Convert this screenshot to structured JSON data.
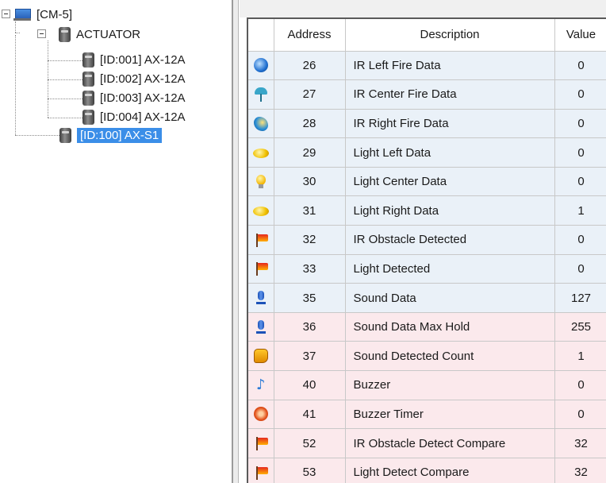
{
  "tree": {
    "root": "[CM-5]",
    "group": "ACTUATOR",
    "children": [
      "[ID:001] AX-12A",
      "[ID:002] AX-12A",
      "[ID:003] AX-12A",
      "[ID:004] AX-12A"
    ],
    "selected": "[ID:100] AX-S1"
  },
  "table": {
    "headers": {
      "icon": "",
      "address": "Address",
      "description": "Description",
      "value": "Value"
    },
    "rows": [
      {
        "icon": "ir-left-icon",
        "address": "26",
        "description": "IR Left Fire Data",
        "value": "0",
        "access": "read-only"
      },
      {
        "icon": "ir-center-icon",
        "address": "27",
        "description": "IR Center Fire Data",
        "value": "0",
        "access": "read-only"
      },
      {
        "icon": "ir-right-icon",
        "address": "28",
        "description": "IR Right Fire Data",
        "value": "0",
        "access": "read-only"
      },
      {
        "icon": "light-left-icon",
        "address": "29",
        "description": "Light Left Data",
        "value": "0",
        "access": "read-only"
      },
      {
        "icon": "light-center-icon",
        "address": "30",
        "description": "Light Center Data",
        "value": "0",
        "access": "read-only"
      },
      {
        "icon": "light-right-icon",
        "address": "31",
        "description": "Light Right Data",
        "value": "1",
        "access": "read-only"
      },
      {
        "icon": "flag-icon",
        "address": "32",
        "description": "IR Obstacle Detected",
        "value": "0",
        "access": "read-only"
      },
      {
        "icon": "flag-icon",
        "address": "33",
        "description": "Light Detected",
        "value": "0",
        "access": "read-only"
      },
      {
        "icon": "microphone-icon",
        "address": "35",
        "description": "Sound Data",
        "value": "127",
        "access": "read-only"
      },
      {
        "icon": "microphone-icon",
        "address": "36",
        "description": "Sound Data Max Hold",
        "value": "255",
        "access": "read-write"
      },
      {
        "icon": "hand-icon",
        "address": "37",
        "description": "Sound Detected Count",
        "value": "1",
        "access": "read-write"
      },
      {
        "icon": "music-note-icon",
        "address": "40",
        "description": "Buzzer",
        "value": "0",
        "access": "read-write"
      },
      {
        "icon": "timer-icon",
        "address": "41",
        "description": "Buzzer Timer",
        "value": "0",
        "access": "read-write"
      },
      {
        "icon": "flag-icon",
        "address": "52",
        "description": "IR Obstacle Detect Compare",
        "value": "32",
        "access": "read-write"
      },
      {
        "icon": "flag-icon",
        "address": "53",
        "description": "Light Detect Compare",
        "value": "32",
        "access": "read-write"
      }
    ]
  },
  "colors": {
    "read_only_row": "#eaf1f8",
    "read_write_row": "#fbe9ec",
    "selection": "#3b8ee8"
  }
}
